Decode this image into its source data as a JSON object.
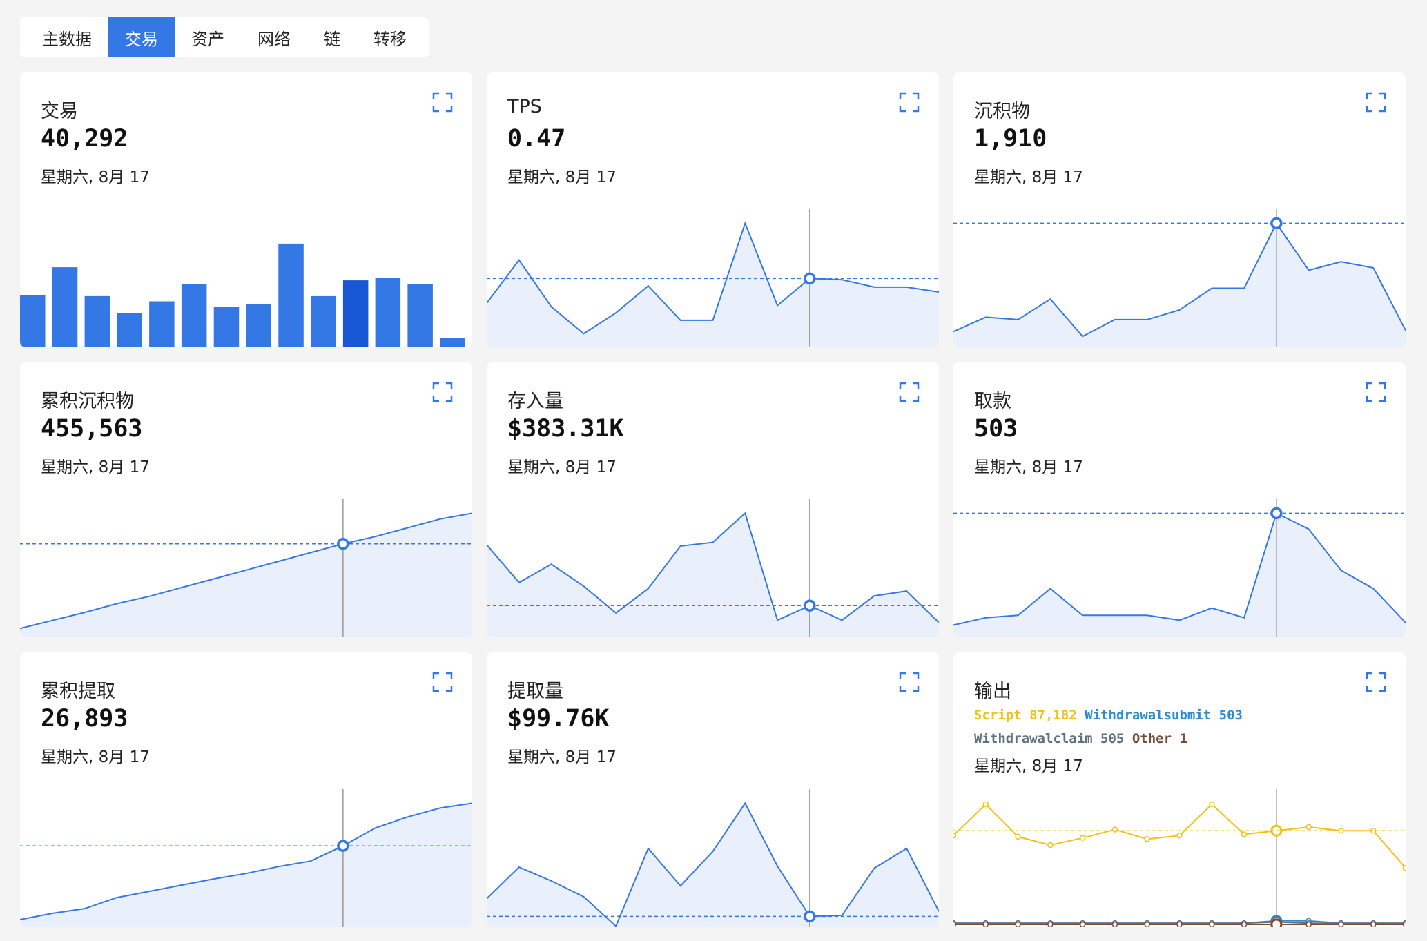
{
  "tabs": [
    "主数据",
    "交易",
    "资产",
    "网络",
    "链",
    "转移"
  ],
  "active_tab": 1,
  "colors": {
    "accent": "#3478e5",
    "fill": "#e9f0fb",
    "bar_highlight": "#1958d4"
  },
  "cards": [
    {
      "title": "交易",
      "value": "40,292",
      "date": "星期六, 8月 17"
    },
    {
      "title": "TPS",
      "value": "0.47",
      "date": "星期六, 8月 17"
    },
    {
      "title": "沉积物",
      "value": "1,910",
      "date": "星期六, 8月 17"
    },
    {
      "title": "累积沉积物",
      "value": "455,563",
      "date": "星期六, 8月 17"
    },
    {
      "title": "存入量",
      "value": "$383.31K",
      "date": "星期六, 8月 17"
    },
    {
      "title": "取款",
      "value": "503",
      "date": "星期六, 8月 17"
    },
    {
      "title": "累积提取",
      "value": "26,893",
      "date": "星期六, 8月 17"
    },
    {
      "title": "提取量",
      "value": "$99.76K",
      "date": "星期六, 8月 17"
    },
    {
      "title": "输出",
      "value": "",
      "date": "星期六, 8月 17"
    }
  ],
  "output_legend": [
    {
      "label": "Script",
      "value": "87,182",
      "color": "#f2c018"
    },
    {
      "label": "Withdrawalsubmit",
      "value": "503",
      "color": "#2a8bd6"
    },
    {
      "label": "Withdrawalclaim",
      "value": "505",
      "color": "#5f7181"
    },
    {
      "label": "Other",
      "value": "1",
      "color": "#7a4b38"
    }
  ],
  "chart_data": [
    {
      "type": "bar",
      "values": [
        40,
        61,
        39,
        26,
        35,
        48,
        31,
        33,
        79,
        39,
        51,
        53,
        48,
        7
      ],
      "highlight_index": 10
    },
    {
      "type": "area",
      "values": [
        36,
        71,
        33,
        11,
        28,
        50,
        22,
        22,
        101,
        34,
        56,
        55,
        49,
        49,
        45
      ],
      "highlight_index": 10
    },
    {
      "type": "area",
      "values": [
        13,
        25,
        23,
        40,
        9,
        23,
        23,
        31,
        49,
        49,
        103,
        64,
        71,
        66,
        14
      ],
      "highlight_index": 10
    },
    {
      "type": "area",
      "values": [
        12,
        23,
        34,
        46,
        56,
        68,
        80,
        92,
        104,
        116,
        128,
        138,
        150,
        162,
        170
      ],
      "highlight_index": 10
    },
    {
      "type": "area",
      "values": [
        76,
        45,
        60,
        42,
        20,
        40,
        75,
        78,
        102,
        14,
        26,
        14,
        34,
        38,
        12
      ],
      "highlight_index": 10
    },
    {
      "type": "area",
      "values": [
        10,
        16,
        18,
        40,
        18,
        18,
        18,
        14,
        24,
        16,
        102,
        89,
        55,
        40,
        12
      ],
      "highlight_index": 10
    },
    {
      "type": "area",
      "values": [
        11,
        20,
        27,
        43,
        52,
        61,
        70,
        78,
        88,
        96,
        118,
        144,
        160,
        173,
        180
      ],
      "highlight_index": 10
    },
    {
      "type": "area",
      "values": [
        29,
        61,
        47,
        31,
        1,
        80,
        42,
        77,
        126,
        62,
        11,
        12,
        60,
        80,
        16
      ],
      "highlight_index": 10
    },
    {
      "type": "line",
      "highlight_index": 10,
      "series": [
        {
          "name": "Script",
          "values": [
            74,
            100,
            73,
            66,
            72,
            79,
            71,
            74,
            100,
            75,
            78,
            81,
            78,
            78,
            47
          ]
        },
        {
          "name": "Withdrawalsubmit",
          "values": [
            1,
            1,
            1,
            1,
            1,
            1,
            1,
            1,
            1,
            1,
            3,
            3,
            1,
            1,
            1
          ]
        },
        {
          "name": "Withdrawalclaim",
          "values": [
            1,
            1,
            1,
            1,
            1,
            1,
            1,
            1,
            1,
            1,
            2,
            1,
            1,
            1,
            1
          ]
        },
        {
          "name": "Other",
          "values": [
            0,
            0,
            0,
            0,
            0,
            0,
            0,
            0,
            0,
            0,
            0,
            0,
            0,
            0,
            0
          ]
        }
      ]
    }
  ]
}
